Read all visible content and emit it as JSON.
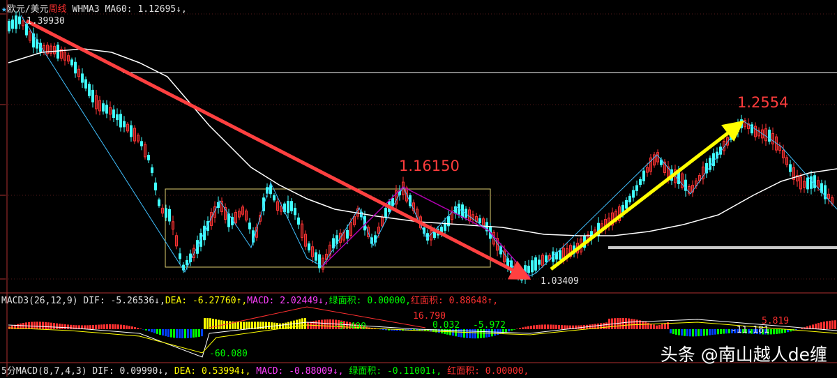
{
  "header_main": {
    "star": "★",
    "pair": "欧元/美元",
    "period": "周线",
    "indicator": "WHMA3",
    "ma_label": "MA60:",
    "ma_value": "1.12695↓,"
  },
  "price_labels": {
    "top": "1.39930",
    "bottom": "1.03409"
  },
  "annotations": {
    "mid_peak": "1.16150",
    "right_peak": "1.2554"
  },
  "header_macd": {
    "name": "MACD3(26,12,9)",
    "dif_label": "DIF:",
    "dif_value": "-5.26536↓,",
    "dea_label": "DEA:",
    "dea_value": "-6.27760↑,",
    "macd_label": "MACD:",
    "macd_value": "2.02449↓,",
    "green_label": "绿面积:",
    "green_value": "0.00000,",
    "red_label": "红面积:",
    "red_value": "0.88648↑,"
  },
  "macd_values": {
    "v1": "-60.080",
    "v2": "16.790",
    "v3": "-5.400",
    "v4": "0.032",
    "v5": "-5.972",
    "v6": "-11.181",
    "v7": "5.819"
  },
  "header_macd2": {
    "name": "5分MACD(8,7,4,3)",
    "dif_label": "DIF:",
    "dif_value": "0.09990↓,",
    "dea_label": "DEA:",
    "dea_value": "0.53994↓,",
    "macd_label": "MACD:",
    "macd_value": "-0.88009↓,",
    "green_label": "绿面积:",
    "green_value": "-0.11001↓,",
    "red_label": "红面积:",
    "red_value": "0.00000,"
  },
  "watermark": "头条 @南山越人de缠",
  "colors": {
    "bull": "#ff3333",
    "bear": "#40ffff",
    "ma": "#ffffff",
    "down_arrow": "#ff4040",
    "up_arrow": "#ffff00",
    "box": "#e0d070",
    "zigzag": "#40c0ff",
    "purple": "#b000b0"
  }
}
